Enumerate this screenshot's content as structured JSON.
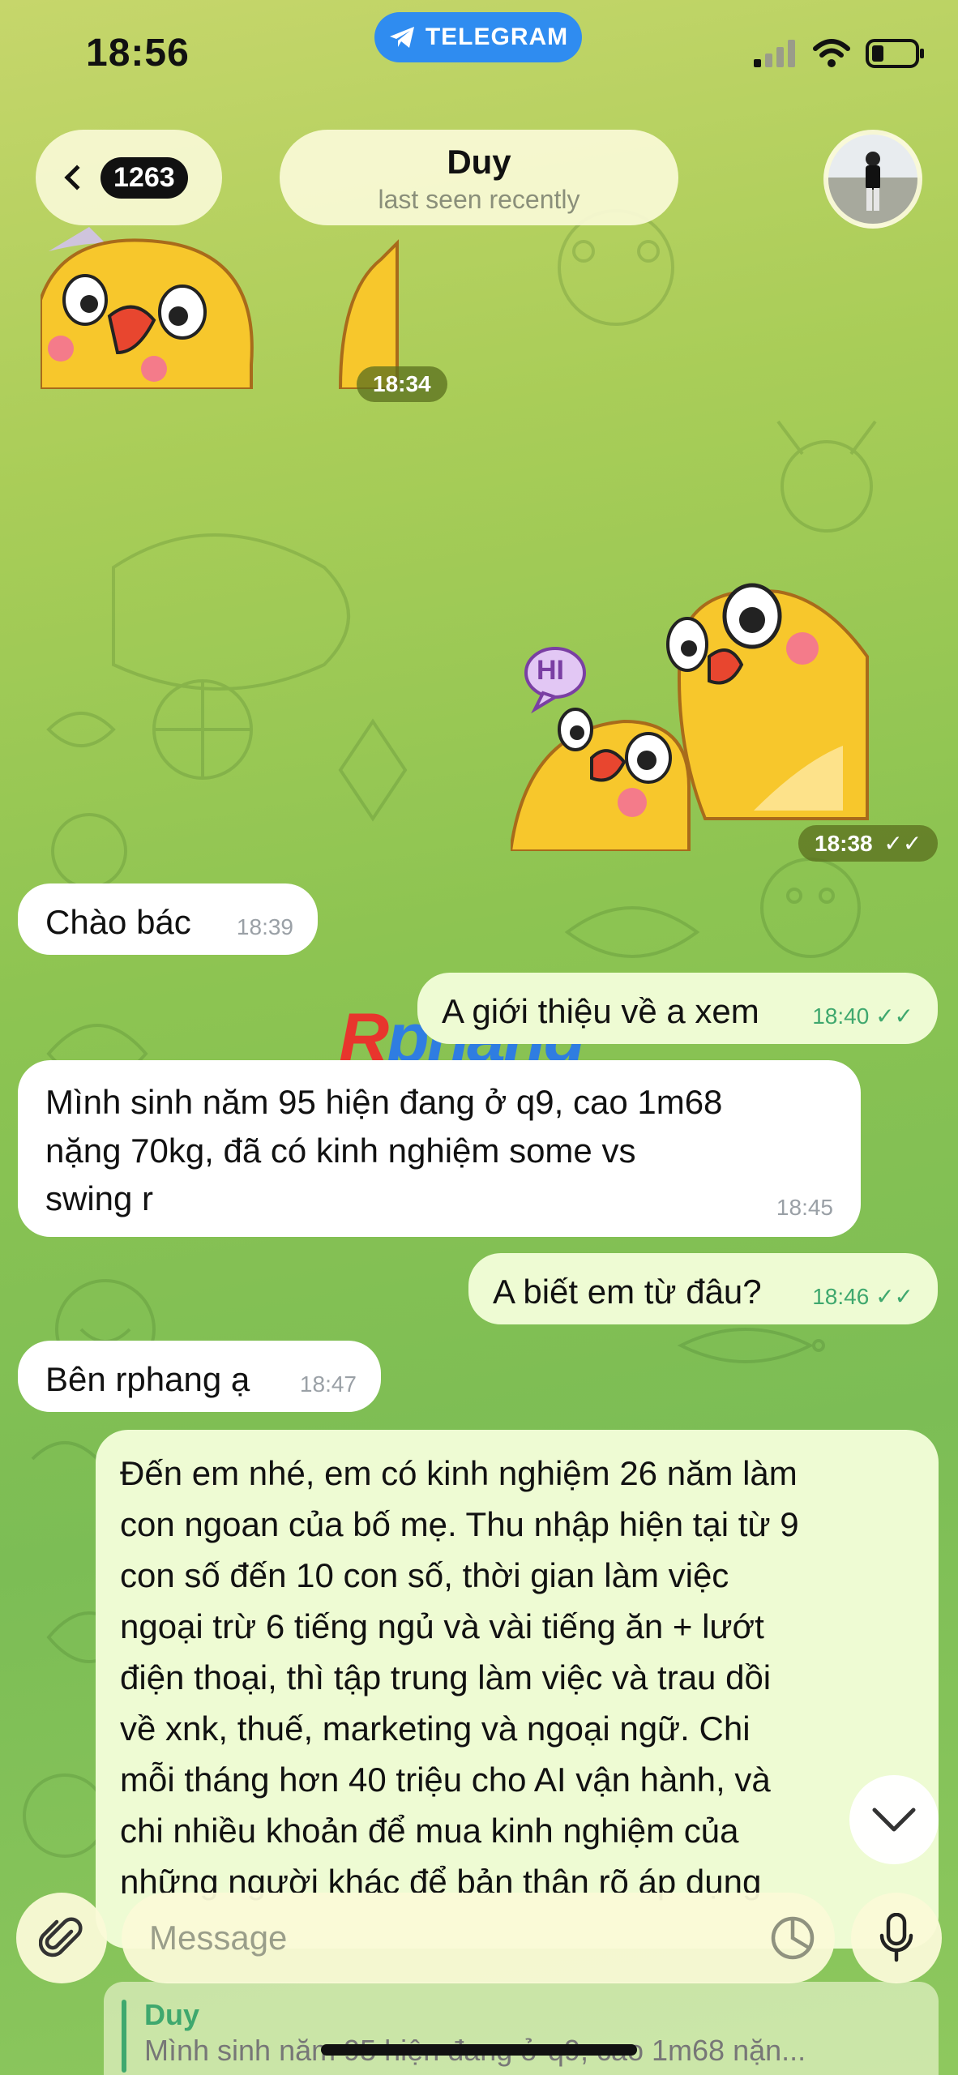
{
  "status_bar": {
    "time": "18:56",
    "app_pill": "TELEGRAM"
  },
  "header": {
    "back_count": "1263",
    "contact_name": "Duy",
    "contact_status": "last seen recently"
  },
  "stickers": [
    {
      "side": "in",
      "time": "18:34"
    },
    {
      "side": "out",
      "time": "18:38",
      "sticker_text": "HI"
    }
  ],
  "messages": [
    {
      "side": "in",
      "text": "Chào bác",
      "time": "18:39"
    },
    {
      "side": "out",
      "text": "A giới thiệu về a xem",
      "time": "18:40"
    },
    {
      "side": "in",
      "lines": [
        "Mình sinh năm 95 hiện đang ở q9, cao 1m68",
        "nặng 70kg, đã có kinh nghiệm some vs",
        "swing r"
      ],
      "time": "18:45"
    },
    {
      "side": "out",
      "text": "A biết em từ đâu?",
      "time": "18:46"
    },
    {
      "side": "in",
      "text": "Bên rphang ạ",
      "time": "18:47"
    },
    {
      "side": "out",
      "lines": [
        "Đến em nhé, em có kinh nghiệm 26 năm làm",
        "con ngoan của bố mẹ. Thu nhập hiện tại từ 9",
        "con số đến 10 con số, thời gian làm việc",
        "ngoại trừ 6 tiếng ngủ và vài tiếng ăn + lướt",
        "điện thoại, thì tập trung làm việc và trau dồi",
        "về xnk, thuế, marketing và ngoại ngữ. Chi",
        "mỗi tháng hơn 40 triệu cho AI vận hành, và",
        "chi nhiều khoản để mua kinh nghiệm của",
        "những người khác để bản thân rõ áp dụng"
      ]
    }
  ],
  "watermark": {
    "part1": "R",
    "part2": "phang"
  },
  "composer": {
    "placeholder": "Message"
  },
  "reply_preview": {
    "name": "Duy",
    "text": "Mình sinh năm 95 hiện đang ở q9, cao 1m68 nặn..."
  },
  "colors": {
    "incoming_bubble": "#ffffff",
    "outgoing_bubble": "#eefbd3",
    "accent_green": "#3fa86e",
    "telegram_blue": "#2f8cf0"
  }
}
